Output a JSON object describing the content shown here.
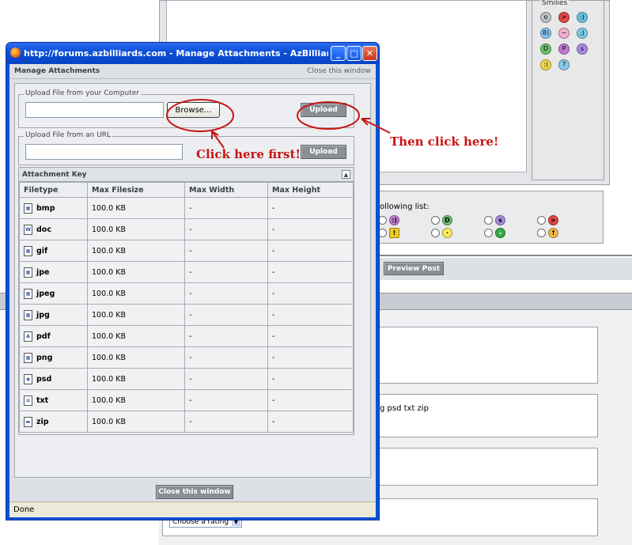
{
  "window": {
    "title": "http://forums.azbilliards.com - Manage Attachments - AzBilliards Fo...",
    "status": "Done"
  },
  "manager": {
    "title": "Manage Attachments",
    "close_link": "Close this window",
    "upload_computer_legend": "Upload File from your Computer",
    "browse_label": "Browse...",
    "upload_label": "Upload",
    "upload_url_legend": "Upload File from an URL",
    "upload_url_label": "Upload",
    "attachment_key_title": "Attachment Key",
    "columns": [
      "Filetype",
      "Max Filesize",
      "Max Width",
      "Max Height"
    ],
    "rows": [
      {
        "type": "bmp",
        "size": "100.0 KB",
        "width": "-",
        "height": "-",
        "icon": "image-file-icon"
      },
      {
        "type": "doc",
        "size": "100.0 KB",
        "width": "-",
        "height": "-",
        "icon": "word-file-icon"
      },
      {
        "type": "gif",
        "size": "100.0 KB",
        "width": "-",
        "height": "-",
        "icon": "image-file-icon"
      },
      {
        "type": "jpe",
        "size": "100.0 KB",
        "width": "-",
        "height": "-",
        "icon": "image-file-icon"
      },
      {
        "type": "jpeg",
        "size": "100.0 KB",
        "width": "-",
        "height": "-",
        "icon": "image-file-icon"
      },
      {
        "type": "jpg",
        "size": "100.0 KB",
        "width": "-",
        "height": "-",
        "icon": "image-file-icon"
      },
      {
        "type": "pdf",
        "size": "100.0 KB",
        "width": "-",
        "height": "-",
        "icon": "pdf-file-icon"
      },
      {
        "type": "png",
        "size": "100.0 KB",
        "width": "-",
        "height": "-",
        "icon": "image-file-icon"
      },
      {
        "type": "psd",
        "size": "100.0 KB",
        "width": "-",
        "height": "-",
        "icon": "psd-file-icon"
      },
      {
        "type": "txt",
        "size": "100.0 KB",
        "width": "-",
        "height": "-",
        "icon": "text-file-icon"
      },
      {
        "type": "zip",
        "size": "100.0 KB",
        "width": "-",
        "height": "-",
        "icon": "zip-file-icon"
      }
    ],
    "close_button": "Close this window"
  },
  "annotations": {
    "first": "Click here first!",
    "then": "Then click here!",
    "color": "#c81414"
  },
  "background": {
    "smilies_label": "Smilies",
    "list_text": "ollowing list:",
    "preview_button": "Preview Post",
    "file_types_text": "g psd txt zip",
    "rating_select": "Choose a rating"
  }
}
